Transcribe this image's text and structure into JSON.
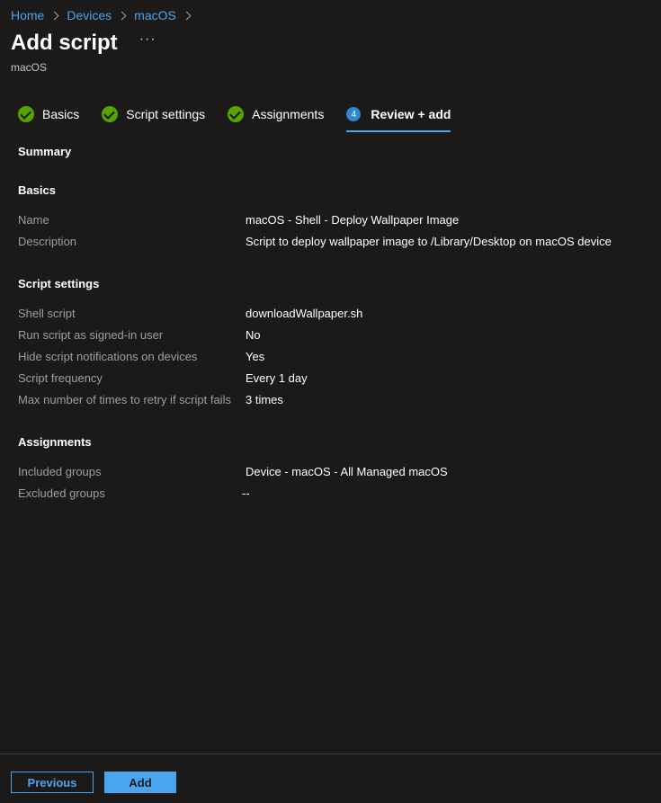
{
  "breadcrumb": {
    "items": [
      "Home",
      "Devices",
      "macOS"
    ]
  },
  "header": {
    "title": "Add script",
    "more": "···",
    "subtitle": "macOS"
  },
  "wizard": {
    "tabs": [
      {
        "label": "Basics",
        "state": "completed"
      },
      {
        "label": "Script settings",
        "state": "completed"
      },
      {
        "label": "Assignments",
        "state": "completed"
      },
      {
        "label": "Review + add",
        "state": "active",
        "step": "4"
      }
    ]
  },
  "summary": {
    "heading": "Summary",
    "basics": {
      "title": "Basics",
      "rows": [
        {
          "key": "Name",
          "value": "macOS - Shell - Deploy Wallpaper Image"
        },
        {
          "key": "Description",
          "value": "Script to deploy wallpaper image to /Library/Desktop on macOS device"
        }
      ]
    },
    "script_settings": {
      "title": "Script settings",
      "rows": [
        {
          "key": "Shell script",
          "value": "downloadWallpaper.sh"
        },
        {
          "key": "Run script as signed-in user",
          "value": "No"
        },
        {
          "key": "Hide script notifications on devices",
          "value": "Yes"
        },
        {
          "key": "Script frequency",
          "value": "Every 1 day"
        },
        {
          "key": "Max number of times to retry if script fails",
          "value": "3 times"
        }
      ]
    },
    "assignments": {
      "title": "Assignments",
      "rows": [
        {
          "key": "Included groups",
          "value": "Device - macOS - All Managed macOS"
        },
        {
          "key": "Excluded groups",
          "value": "--"
        }
      ]
    }
  },
  "footer": {
    "previous_label": "Previous",
    "add_label": "Add"
  },
  "colors": {
    "background": "#1b1a19",
    "accent": "#4aa5f0",
    "success": "#57a300"
  }
}
